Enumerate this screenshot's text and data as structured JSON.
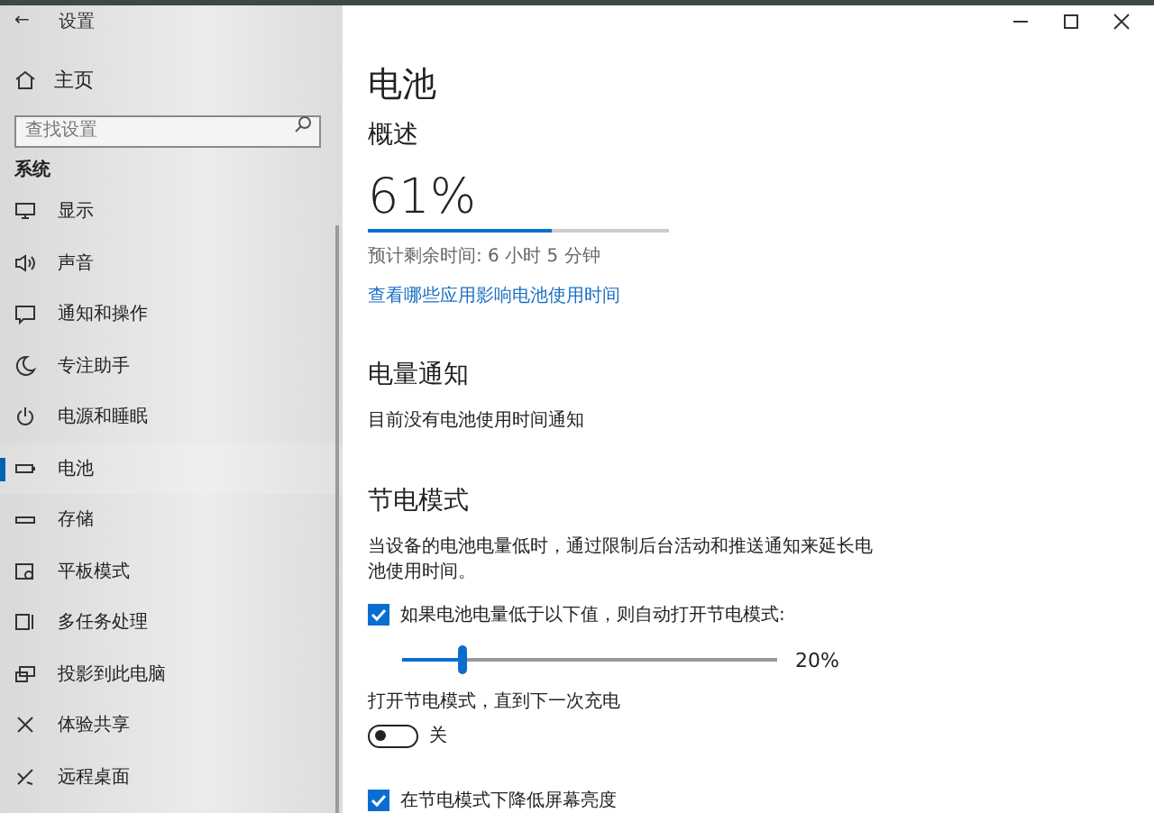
{
  "window": {
    "title": "设置",
    "back": "←"
  },
  "sidebar": {
    "home": "主页",
    "search": {
      "placeholder": "查找设置"
    },
    "section": "系统",
    "items": [
      {
        "label": "显示",
        "selected": false
      },
      {
        "label": "声音",
        "selected": false
      },
      {
        "label": "通知和操作",
        "selected": false
      },
      {
        "label": "专注助手",
        "selected": false
      },
      {
        "label": "电源和睡眠",
        "selected": false
      },
      {
        "label": "电池",
        "selected": true
      },
      {
        "label": "存储",
        "selected": false
      },
      {
        "label": "平板模式",
        "selected": false
      },
      {
        "label": "多任务处理",
        "selected": false
      },
      {
        "label": "投影到此电脑",
        "selected": false
      },
      {
        "label": "体验共享",
        "selected": false
      },
      {
        "label": "远程桌面",
        "selected": false
      }
    ]
  },
  "page": {
    "title": "电池",
    "overview": {
      "heading": "概述",
      "percent": "61%",
      "level": 0.61,
      "remaining": "预计剩余时间: 6 小时 5 分钟",
      "link": "查看哪些应用影响电池使用时间"
    },
    "notifications": {
      "heading": "电量通知",
      "text": "目前没有电池使用时间通知"
    },
    "saver": {
      "heading": "节电模式",
      "description": "当设备的电池电量低时，通过限制后台活动和推送通知来延长电池使用时间。",
      "auto": {
        "label": "如果电池电量低于以下值，则自动打开节电模式:",
        "checked": true
      },
      "threshold": {
        "level": 0.16,
        "reading": "20%"
      },
      "until_charge": {
        "label": "打开节电模式，直到下一次充电",
        "on": false,
        "state": "关"
      },
      "dim": {
        "label": "在节电模式下降低屏幕亮度",
        "checked": true
      }
    }
  }
}
